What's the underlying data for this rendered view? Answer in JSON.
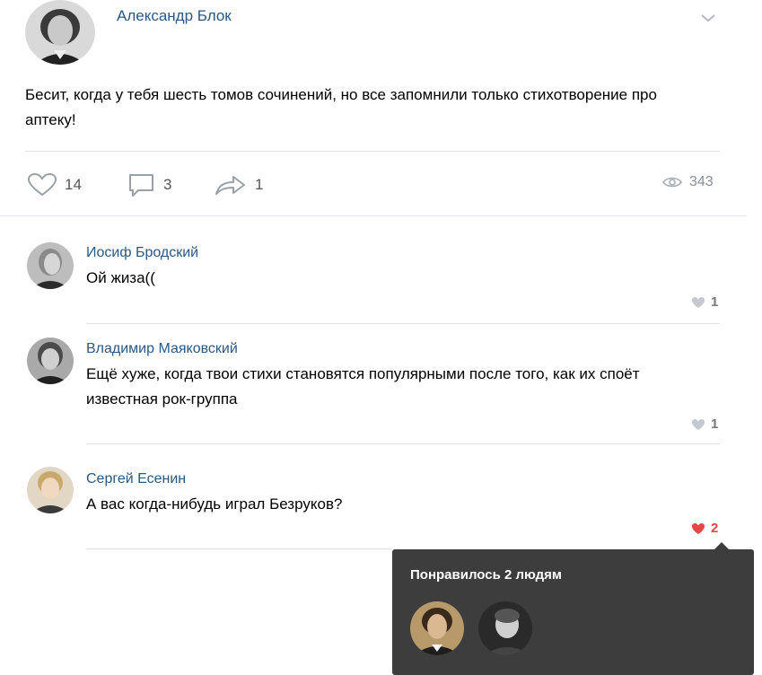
{
  "post": {
    "author": "Александр Блок",
    "avatar_icon": "avatar-blok-photo",
    "text": "Бесит, когда у тебя шесть томов сочинений, но все запомнили только стихотворение про аптеку!",
    "likes": "14",
    "comments": "3",
    "shares": "1",
    "views": "343"
  },
  "comments": [
    {
      "author": "Иосиф Бродский",
      "text": "Ой жиза((",
      "likes": "1",
      "liked": false,
      "avatar_icon": "avatar-brodsky-photo"
    },
    {
      "author": "Владимир Маяковский",
      "text": "Ещё хуже, когда твои стихи становятся популярными после того, как их споёт известная рок-группа",
      "likes": "1",
      "liked": false,
      "avatar_icon": "avatar-mayakovsky-photo"
    },
    {
      "author": "Сергей Есенин",
      "text": "А вас когда-нибудь играл Безруков?",
      "likes": "2",
      "liked": true,
      "avatar_icon": "avatar-esenin-photo"
    }
  ],
  "tooltip": {
    "title": "Понравилось 2 людям",
    "avatars": [
      "avatar-pushkin-photo",
      "avatar-bezrukov-photo"
    ]
  },
  "colors": {
    "link": "#2a5885",
    "liked": "#e64646",
    "tooltip_bg": "#3d3d3d",
    "divider": "#dfe2e8"
  }
}
